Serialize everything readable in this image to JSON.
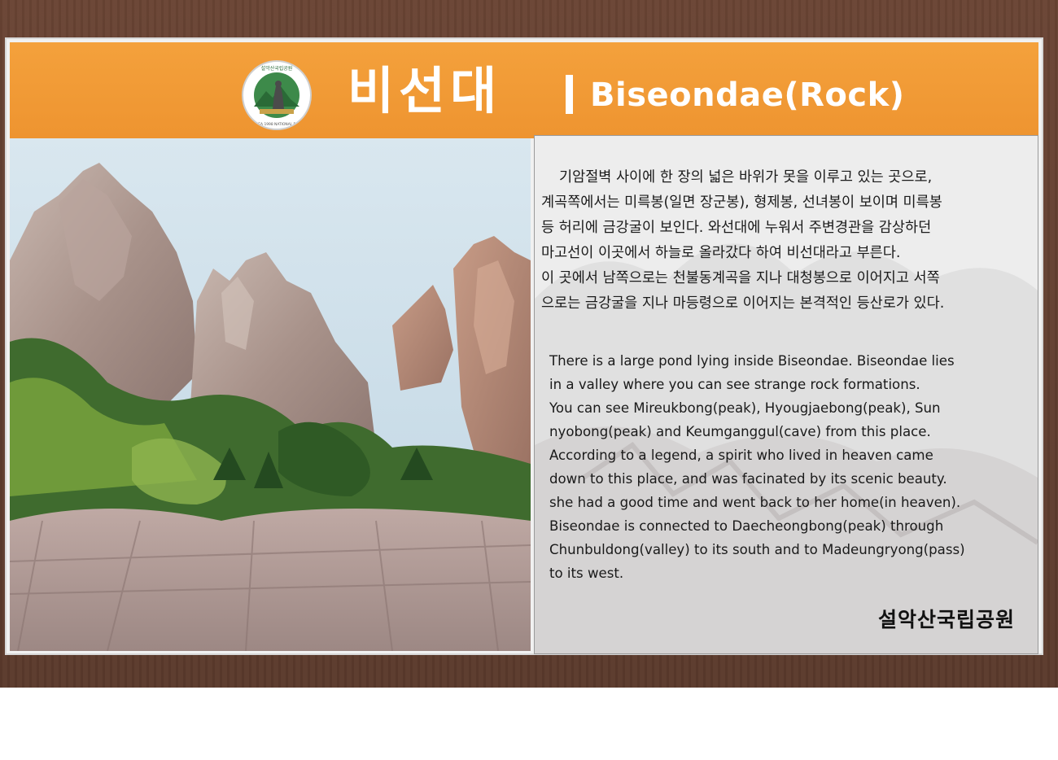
{
  "sign": {
    "title_korean": "비선대",
    "title_separator": "|",
    "title_english": "Biseondae(Rock)",
    "logo_alt": "Seoraksan National Park emblem",
    "logo_text_top": "설악산국립공원",
    "logo_text_bottom": "KOREA 1998 NATIONAL PARK",
    "korean_lines": [
      "기암절벽 사이에 한 장의 넓은 바위가 못을 이루고 있는 곳으로,",
      "계곡쪽에서는 미륵봉(일면 장군봉), 형제봉, 선녀봉이 보이며 미륵봉",
      "등 허리에 금강굴이 보인다. 와선대에 누워서 주변경관을 감상하던",
      "마고선이 이곳에서 하늘로 올라갔다 하여 비선대라고 부른다.",
      "이 곳에서 남쪽으로는 천불동계곡을 지나 대청봉으로 이어지고 서쪽",
      "으로는 금강굴을 지나 마등령으로 이어지는 본격적인 등산로가 있다."
    ],
    "english_lines": [
      "There is a large pond lying inside Biseondae. Biseondae lies",
      "in a valley where you can see strange rock formations.",
      "You can see Mireukbong(peak), Hyougjaebong(peak), Sun",
      "nyobong(peak) and Keumganggul(cave) from this place.",
      "According to a legend, a spirit who lived in heaven came",
      "down to this place, and was facinated by its scenic beauty.",
      "she had a good time and went back to her home(in heaven).",
      "Biseondae is connected to Daecheongbong(peak) through",
      "Chunbuldong(valley) to its south and to Madeungryong(pass)",
      "to its west."
    ],
    "organization": "설악산국립공원"
  },
  "colors": {
    "banner": "#f09a35",
    "wood": "#5e3d2f",
    "panel": "#ececec",
    "text": "#1a1a1a"
  }
}
